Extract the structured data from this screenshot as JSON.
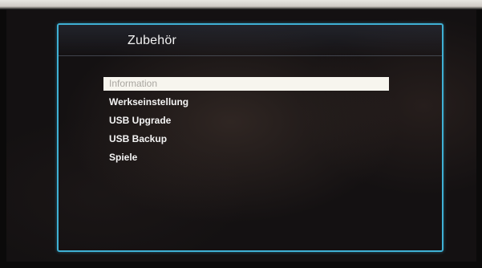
{
  "menu": {
    "title": "Zubehör",
    "items": [
      {
        "label": "Information",
        "selected": true
      },
      {
        "label": "Werkseinstellung",
        "selected": false
      },
      {
        "label": "USB Upgrade",
        "selected": false
      },
      {
        "label": "USB Backup",
        "selected": false
      },
      {
        "label": "Spiele",
        "selected": false
      }
    ]
  },
  "colors": {
    "panel_border": "#3fb0d4",
    "highlight_bg": "#f7f5ee",
    "highlight_text": "#a9a6a0",
    "item_text": "#f4f4f4"
  }
}
